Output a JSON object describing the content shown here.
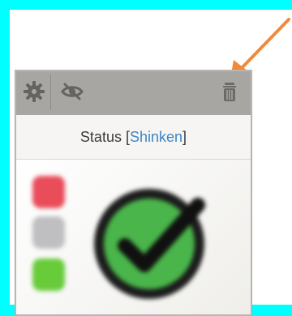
{
  "widget": {
    "status_label": "Status",
    "bracket_open": "[",
    "module_name": "Shinken",
    "bracket_close": "]",
    "state": "OK"
  },
  "icons": {
    "settings": "gear-icon",
    "hide": "eye-slash-icon",
    "delete": "trash-icon"
  },
  "colors": {
    "background": "#00ffff",
    "arrow": "#f08a3c",
    "toolbar": "#a8a6a3",
    "module_link": "#3d86c6",
    "traffic_light_red": "#e84d59",
    "traffic_light_gray": "#bfbec0",
    "traffic_light_green": "#68cb3a",
    "status_ok": "#49b54a"
  }
}
